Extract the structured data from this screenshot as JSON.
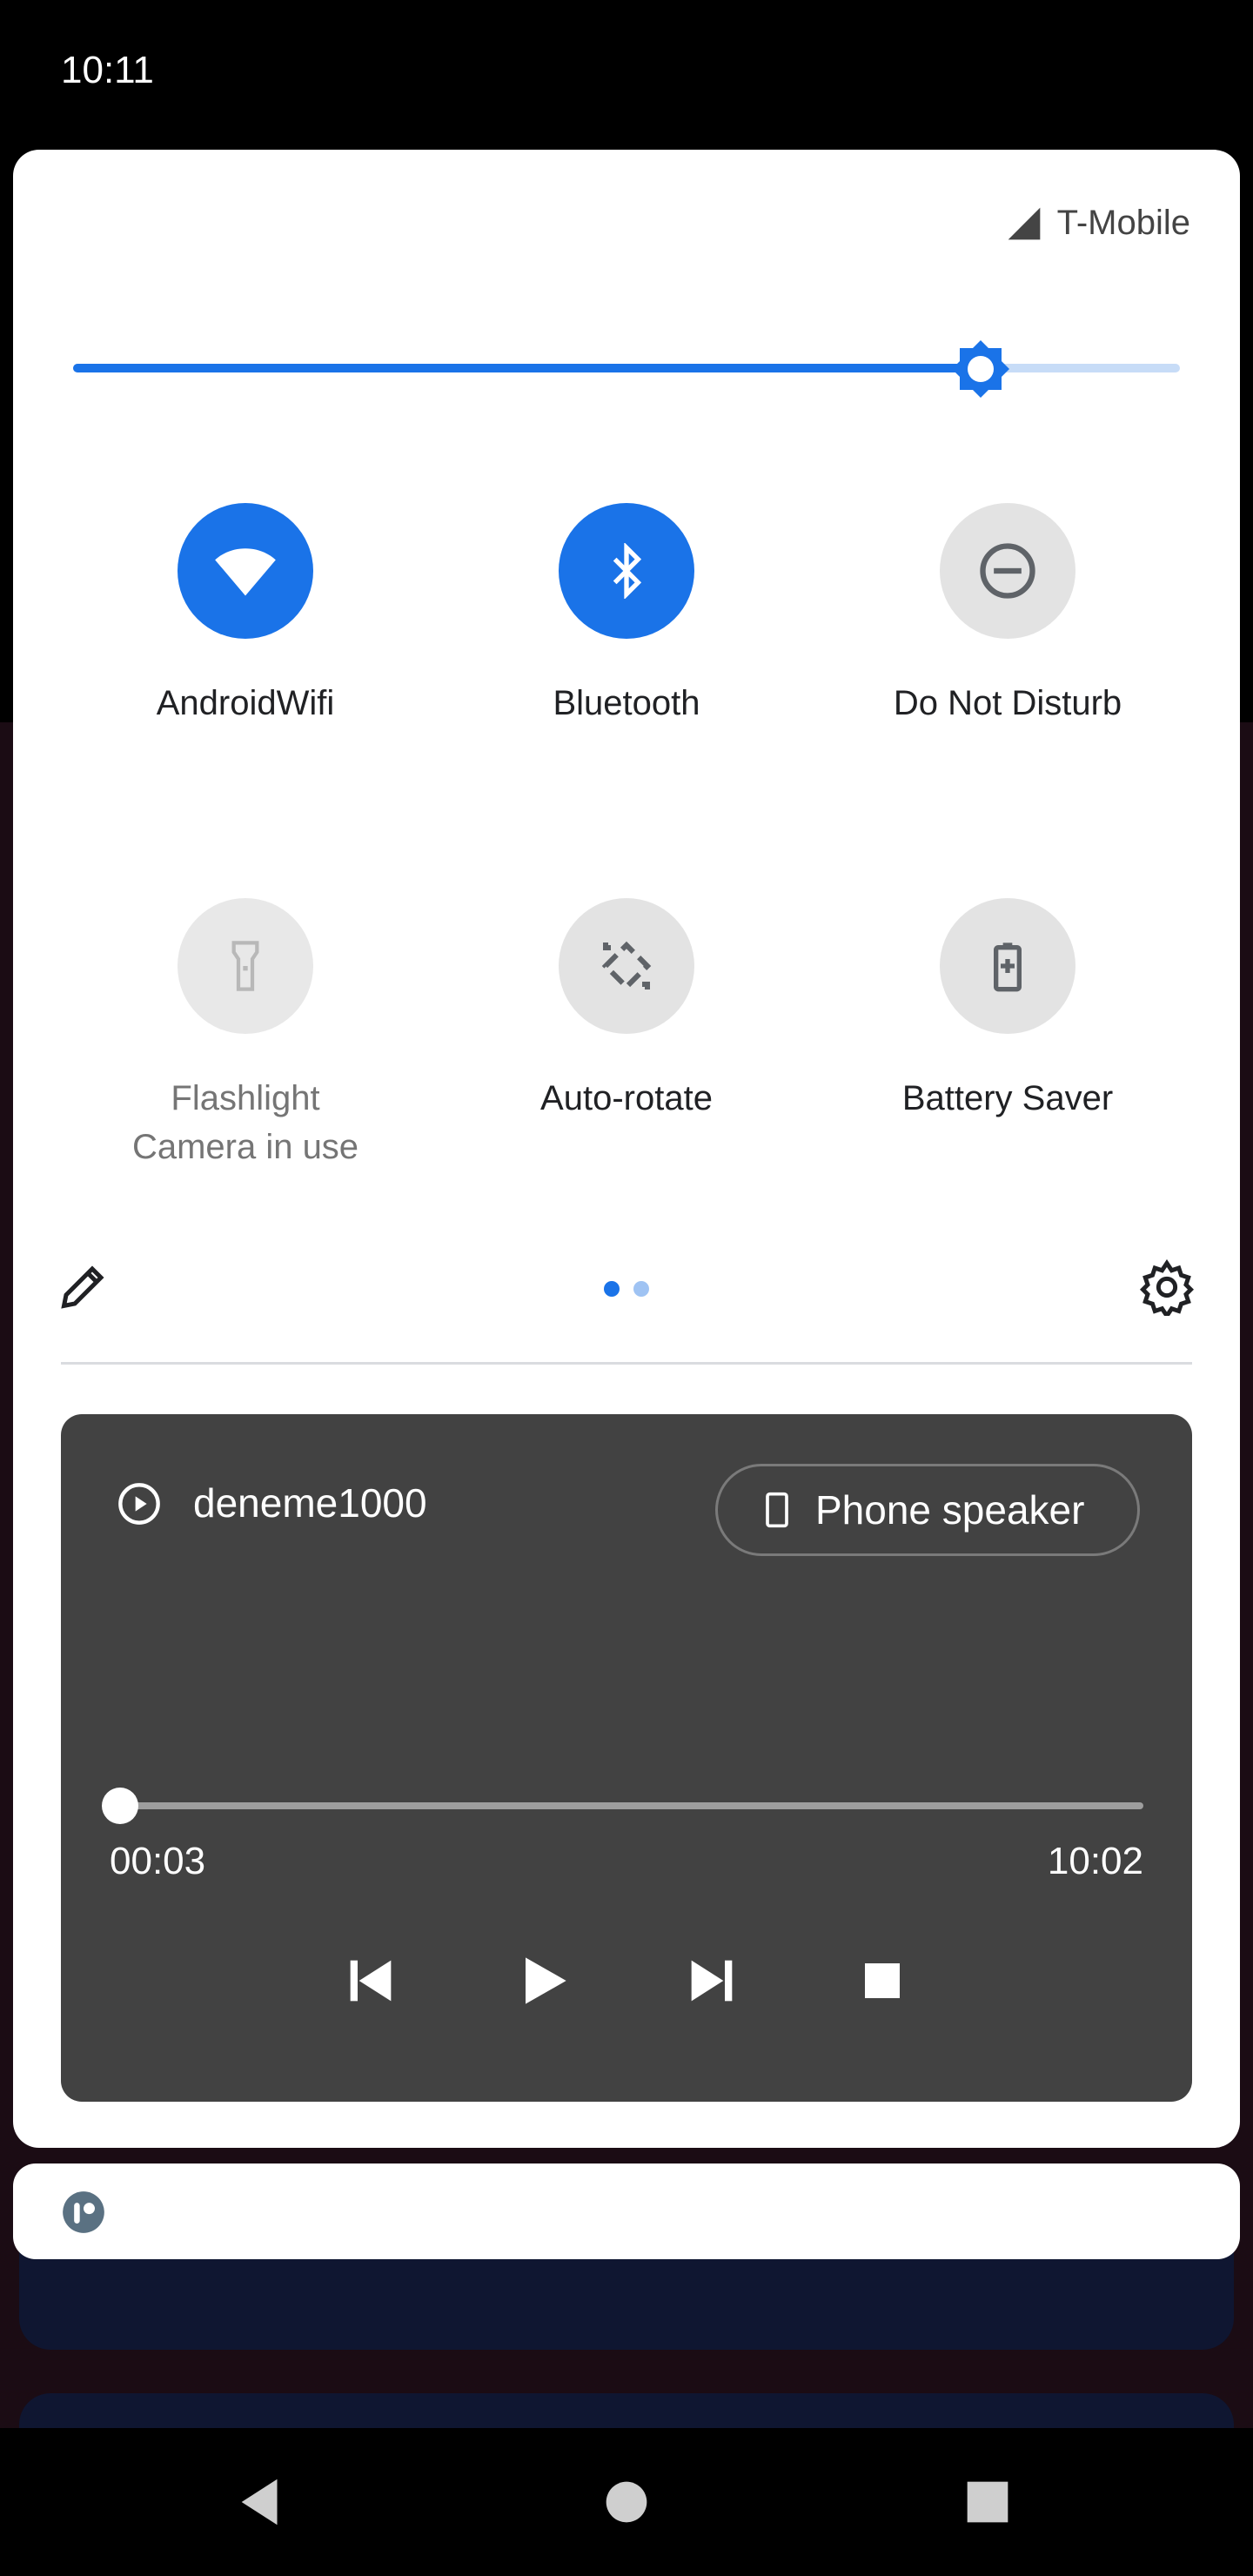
{
  "status_bar": {
    "time": "10:11"
  },
  "quick_settings": {
    "carrier": "T-Mobile",
    "brightness": 0.82,
    "tiles": [
      {
        "label": "AndroidWifi",
        "icon": "wifi-icon",
        "state": "on"
      },
      {
        "label": "Bluetooth",
        "icon": "bluetooth-icon",
        "state": "on"
      },
      {
        "label": "Do Not Disturb",
        "icon": "do-not-disturb-icon",
        "state": "off"
      },
      {
        "label": "Flashlight",
        "sublabel": "Camera in use",
        "icon": "flashlight-icon",
        "state": "unavailable"
      },
      {
        "label": "Auto-rotate",
        "icon": "auto-rotate-icon",
        "state": "off"
      },
      {
        "label": "Battery Saver",
        "icon": "battery-saver-icon",
        "state": "off"
      }
    ],
    "page_indicator": {
      "pages": 2,
      "current": 1
    }
  },
  "media": {
    "title": "deneme1000",
    "output_device": "Phone speaker",
    "elapsed": "00:03",
    "total": "10:02",
    "progress": 0.005
  },
  "colors": {
    "accent": "#1a73e8",
    "media_bg": "#424242",
    "tile_off": "#e3e3e3"
  }
}
